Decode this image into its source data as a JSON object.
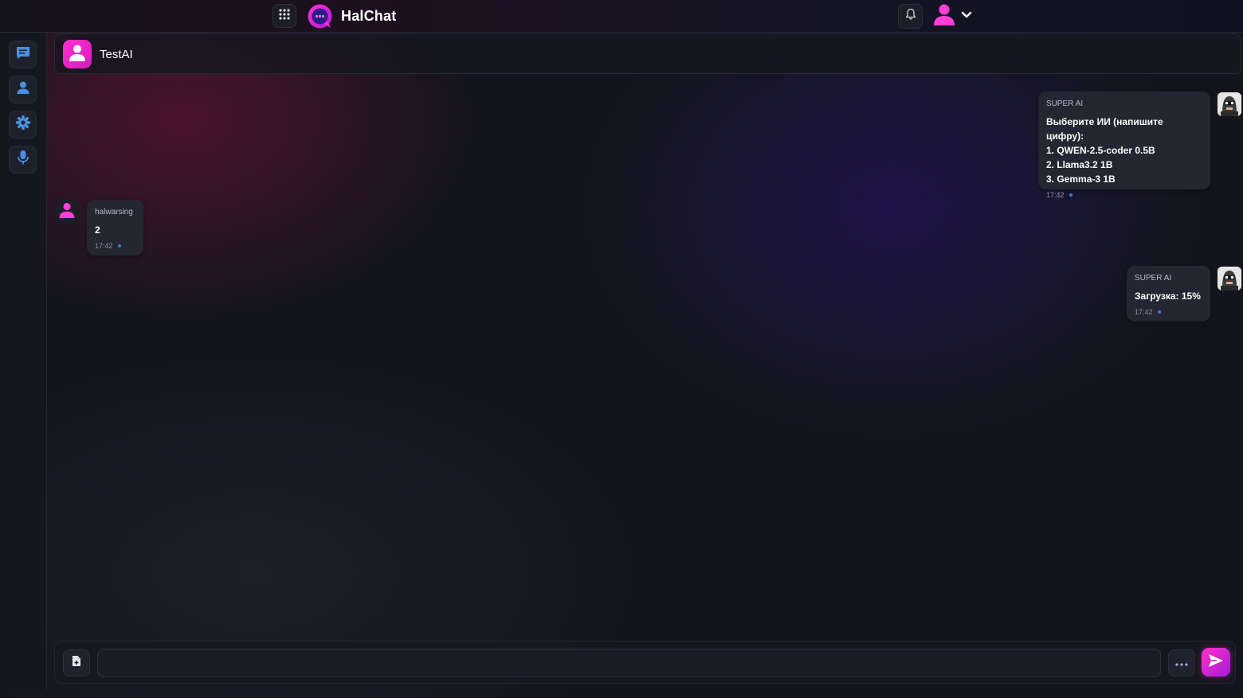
{
  "app": {
    "brand": "HalChat"
  },
  "icons": {
    "apps": "grid-icon",
    "logo": "chat-bubble-logo-icon",
    "notifications": "bell-icon",
    "user": "user-icon",
    "user_menu_toggle": "chevron-down-icon",
    "rail": [
      "chat-icon",
      "contacts-icon",
      "gear-icon",
      "microphone-icon"
    ],
    "attach": "file-icon",
    "more": "ellipsis-icon",
    "send": "send-icon"
  },
  "colors": {
    "accent": "#ff2fd0",
    "rail_icon": "#4a90e2",
    "read_dot": "#3e7bd6"
  },
  "chat": {
    "title": "TestAI"
  },
  "messages": [
    {
      "side": "right",
      "sender": "SUPER AI",
      "text": "Выберите ИИ (напишите цифру):\n1. QWEN-2.5-coder 0.5B\n2. Llama3.2 1B\n3. Gemma-3 1B",
      "time": "17:42"
    },
    {
      "side": "left",
      "sender": "halwarsing",
      "text": "2",
      "time": "17:42"
    },
    {
      "side": "right",
      "sender": "SUPER AI",
      "text": "Загрузка: 15%",
      "time": "17:42"
    }
  ],
  "composer": {
    "value": "",
    "placeholder": ""
  }
}
